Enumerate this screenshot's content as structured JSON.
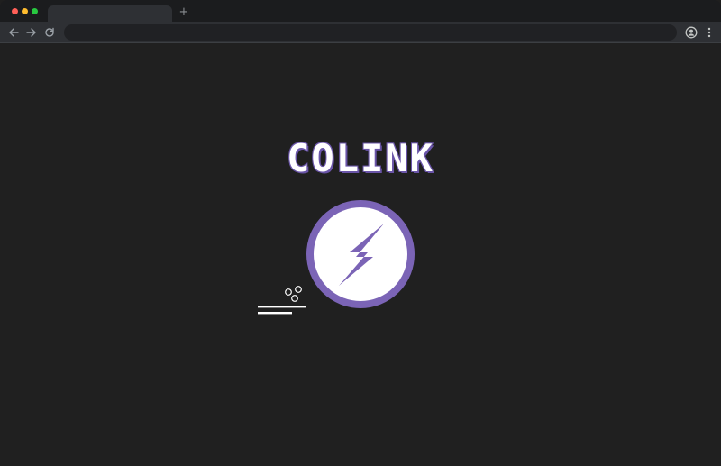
{
  "browser": {
    "tab_title": "",
    "new_tab_label": "+",
    "address": "",
    "icons": {
      "back": "arrow-left-icon",
      "forward": "arrow-right-icon",
      "reload": "reload-icon",
      "profile": "profile-icon",
      "menu": "kebab-menu-icon"
    }
  },
  "page": {
    "brand_name": "COLINK",
    "brand_icon": "lightning-bolt-icon"
  },
  "colors": {
    "background": "#202020",
    "accent_purple": "#7b64b6",
    "white": "#ffffff",
    "traffic_close": "#ff5f57",
    "traffic_minimize": "#febc2e",
    "traffic_maximize": "#28c840"
  }
}
